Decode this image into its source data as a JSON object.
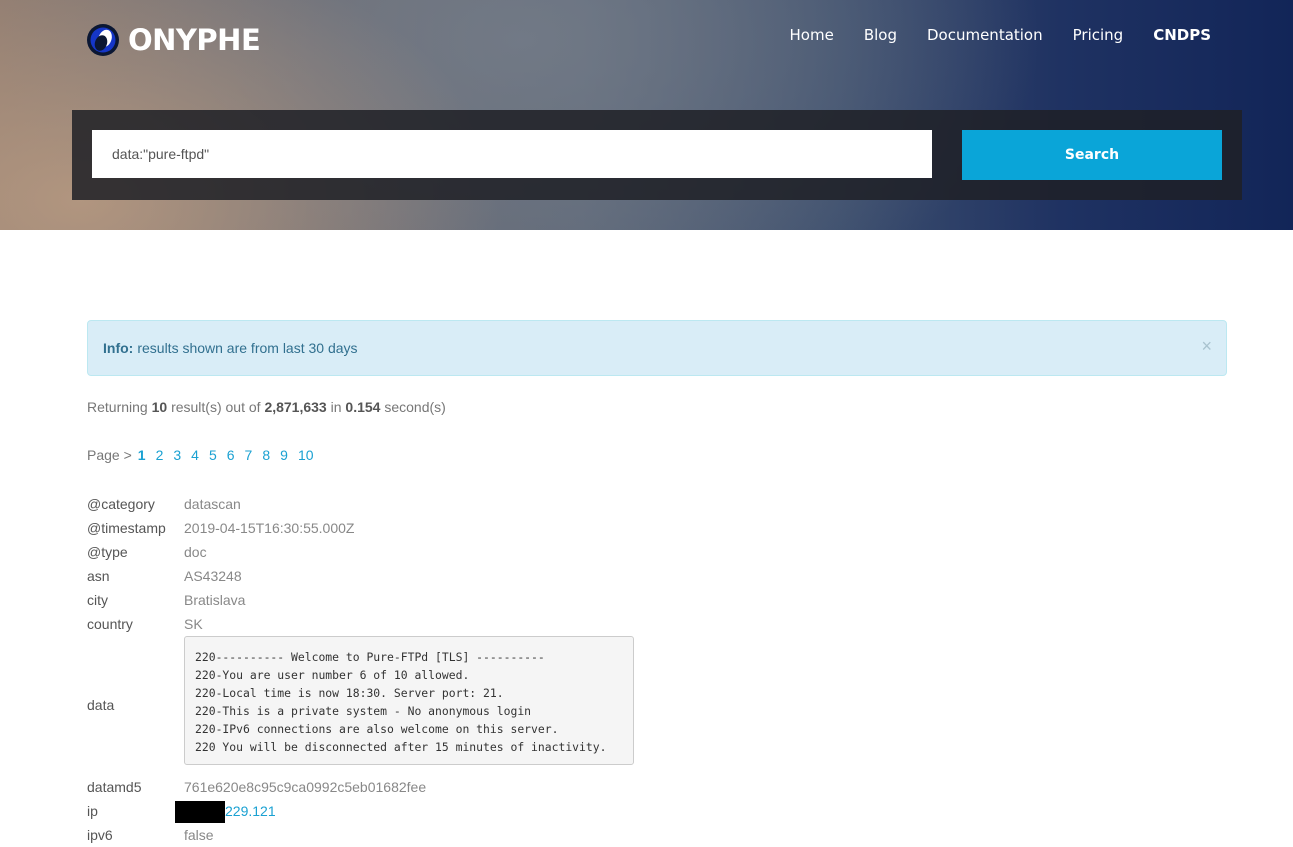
{
  "header": {
    "logo_text": "ONYPHE",
    "nav": [
      "Home",
      "Blog",
      "Documentation",
      "Pricing",
      "CNDPS"
    ]
  },
  "search": {
    "value": "data:\"pure-ftpd\"",
    "button_label": "Search"
  },
  "alert": {
    "label": "Info:",
    "message": "results shown are from last 30 days",
    "close": "×"
  },
  "summary": {
    "prefix": "Returning",
    "count": "10",
    "mid": "result(s) out of",
    "total": "2,871,633",
    "in": "in",
    "time": "0.154",
    "suffix": "second(s)"
  },
  "pager": {
    "label": "Page >",
    "pages": [
      "1",
      "2",
      "3",
      "4",
      "5",
      "6",
      "7",
      "8",
      "9",
      "10"
    ],
    "current": "1"
  },
  "record": {
    "category": {
      "key": "@category",
      "value": "datascan"
    },
    "timestamp": {
      "key": "@timestamp",
      "value": "2019-04-15T16:30:55.000Z"
    },
    "type": {
      "key": "@type",
      "value": "doc"
    },
    "asn": {
      "key": "asn",
      "value": "AS43248"
    },
    "city": {
      "key": "city",
      "value": "Bratislava"
    },
    "country": {
      "key": "country",
      "value": "SK"
    },
    "data": {
      "key": "data",
      "value": "220---------- Welcome to Pure-FTPd [TLS] ----------\n220-You are user number 6 of 10 allowed.\n220-Local time is now 18:30. Server port: 21.\n220-This is a private system - No anonymous login\n220-IPv6 connections are also welcome on this server.\n220 You will be disconnected after 15 minutes of inactivity."
    },
    "datamd5": {
      "key": "datamd5",
      "value": "761e620e8c95c9ca0992c5eb01682fee"
    },
    "ip": {
      "key": "ip",
      "value": "229.121"
    },
    "ipv6": {
      "key": "ipv6",
      "value": "false"
    }
  },
  "colors": {
    "accent": "#0aa5d8",
    "link": "#1aa1d2",
    "alert_bg": "#d9edf7"
  }
}
